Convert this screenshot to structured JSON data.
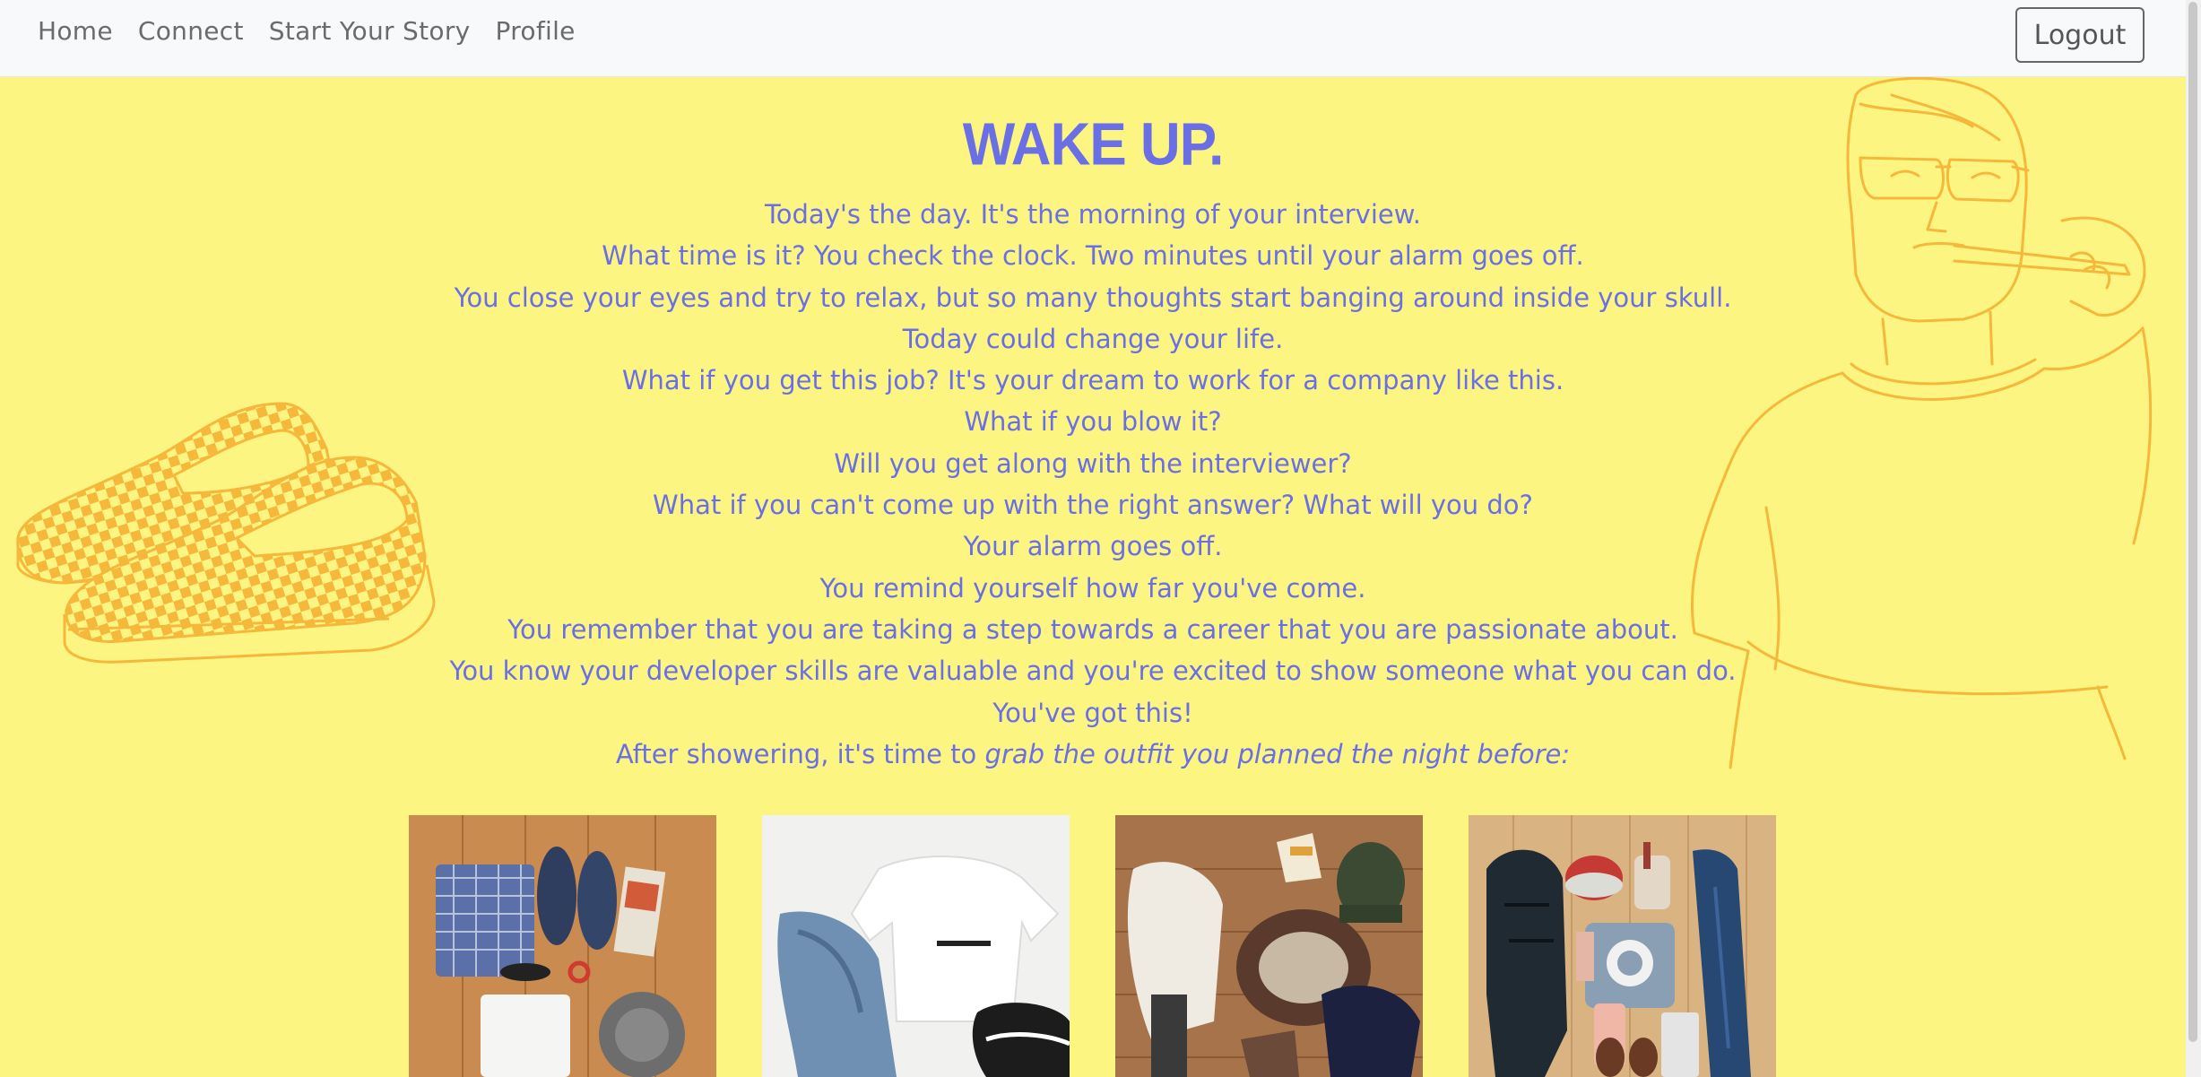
{
  "nav": {
    "links": [
      "Home",
      "Connect",
      "Start Your Story",
      "Profile"
    ],
    "logout": "Logout"
  },
  "story": {
    "title": "WAKE UP.",
    "lines": [
      "Today's the day. It's the morning of your interview.",
      "What time is it? You check the clock. Two minutes until your alarm goes off.",
      "You close your eyes and try to relax, but so many thoughts start banging around inside your skull.",
      "Today could change your life.",
      "What if you get this job? It's your dream to work for a company like this.",
      "What if you blow it?",
      "Will you get along with the interviewer?",
      "What if you can't come up with the right answer? What will you do?",
      "Your alarm goes off.",
      "You remind yourself how far you've come.",
      "You remember that you are taking a step towards a career that you are passionate about.",
      "You know your developer skills are valuable and you're excited to show someone what you can do.",
      "You've got this!"
    ],
    "last_line_prefix": "After showering, it's time to",
    "last_line_emphasis": "grab the outfit you planned the night before:"
  },
  "colors": {
    "background": "#fdf582",
    "accent": "#6a6fe6",
    "illustration": "#f6b83a"
  }
}
